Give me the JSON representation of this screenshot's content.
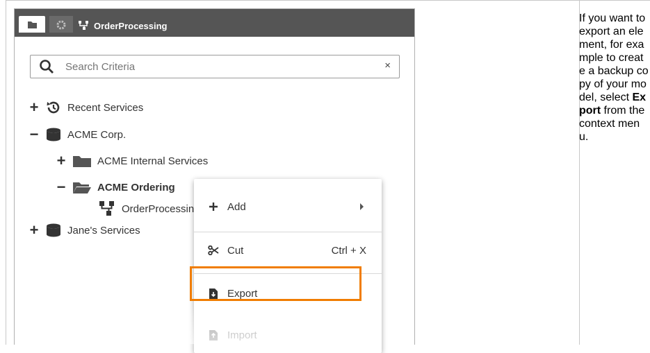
{
  "header": {
    "title": "OrderProcessing",
    "tabs": [
      {
        "icon": "folder-icon"
      },
      {
        "icon": "gear-icon"
      },
      {
        "icon": "model-icon"
      }
    ]
  },
  "search": {
    "placeholder": "Search Criteria",
    "clear_label": "×"
  },
  "tree": {
    "items": [
      {
        "toggle": "+",
        "icon": "recent-icon",
        "label": "Recent Services"
      },
      {
        "toggle": "−",
        "icon": "database-icon",
        "label": "ACME Corp."
      },
      {
        "toggle": "+",
        "icon": "folder-icon",
        "label": "ACME Internal Services"
      },
      {
        "toggle": "−",
        "icon": "folder-open-icon",
        "label": "ACME Ordering"
      },
      {
        "toggle": "",
        "icon": "model-icon",
        "label": "OrderProcessing"
      },
      {
        "toggle": "+",
        "icon": "database-icon",
        "label": "Jane's Services"
      }
    ]
  },
  "context_menu": {
    "items": [
      {
        "icon": "plus-icon",
        "label": "Add",
        "shortcut": "",
        "submenu": true
      },
      {
        "icon": "scissors-icon",
        "label": "Cut",
        "shortcut": "Ctrl + X"
      },
      {
        "icon": "export-icon",
        "label": "Export",
        "shortcut": "",
        "highlighted": true
      },
      {
        "icon": "import-icon",
        "label": "Import",
        "shortcut": "",
        "disabled": true
      }
    ]
  },
  "note": {
    "part1": "If you want to export an element, for example to create a backup copy of your model, select ",
    "bold": "Export",
    "part2": " from the context menu."
  },
  "colors": {
    "header_bg": "#555555",
    "highlight": "#f07d00",
    "text": "#333333"
  }
}
